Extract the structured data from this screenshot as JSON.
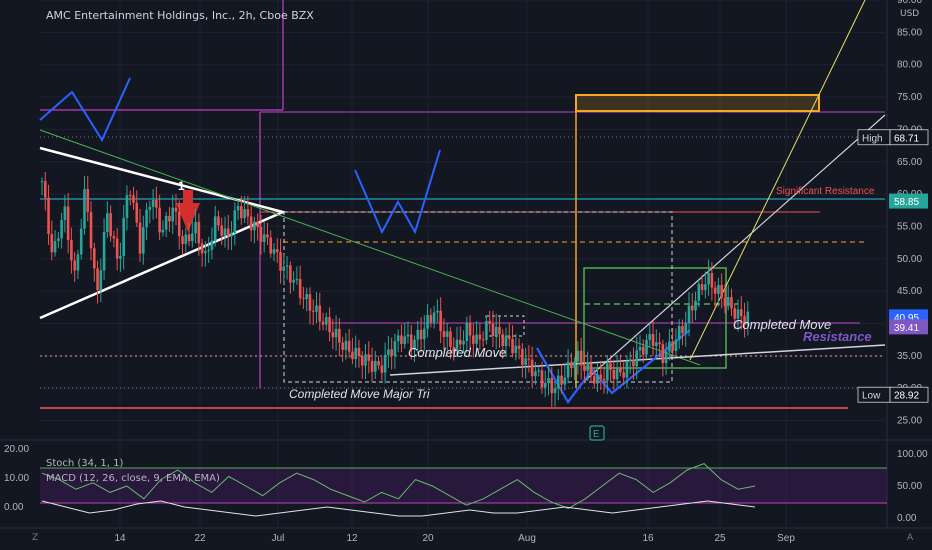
{
  "header": {
    "title": "AMC Entertainment Holdings, Inc., 2h, Cboe BZX",
    "currency": "USD"
  },
  "indicators": {
    "stoch_label": "Stoch (34, 1, 1)",
    "macd_label": "MACD (12, 26, close, 9, EMA, EMA)"
  },
  "corners": {
    "left": "Z",
    "right": "A"
  },
  "colors": {
    "background": "#131722",
    "up": "#26a69a",
    "down": "#ef5350",
    "magenta": "#c040c0",
    "orange": "#f5a623",
    "white": "#ffffff",
    "blue": "#2962ff",
    "green": "#4caf50",
    "purple": "#7e57c2"
  },
  "chart_data": [
    {
      "type": "candlestick",
      "title": "AMC Entertainment Holdings, Inc., 2h, Cboe BZX",
      "x_ticks": [
        "14",
        "22",
        "Jul",
        "12",
        "20",
        "Aug",
        "16",
        "25",
        "Sep"
      ],
      "y_ticks": [
        25,
        30,
        35,
        40,
        45,
        50,
        55,
        60,
        65,
        70,
        75,
        80,
        85,
        90
      ],
      "ylim": [
        22,
        90
      ],
      "price_labels": [
        {
          "text": "High",
          "value": "68.71"
        },
        {
          "text": "",
          "value": "58.85"
        },
        {
          "text": "",
          "value": "40.95"
        },
        {
          "text": "",
          "value": "39.41"
        },
        {
          "text": "Low",
          "value": "28.92"
        }
      ],
      "annotations": {
        "significant_resistance": "Significant Resistance",
        "resistance": "Resistance",
        "completed_move_1": "Completed Move",
        "completed_move_2": "Completed Move",
        "completed_move_major": "Completed Move Major Tri",
        "marker_1": "1",
        "earnings": "E"
      },
      "price_path": [
        [
          0,
          62
        ],
        [
          4,
          50
        ],
        [
          8,
          58
        ],
        [
          12,
          47
        ],
        [
          16,
          61
        ],
        [
          20,
          44
        ],
        [
          24,
          57
        ],
        [
          28,
          49
        ],
        [
          32,
          62
        ],
        [
          36,
          52
        ],
        [
          40,
          60
        ],
        [
          44,
          54
        ],
        [
          48,
          58
        ],
        [
          52,
          52
        ],
        [
          56,
          55
        ],
        [
          60,
          50
        ],
        [
          64,
          56
        ],
        [
          68,
          53
        ],
        [
          72,
          58
        ],
        [
          76,
          56
        ],
        [
          80,
          54
        ],
        [
          84,
          52
        ],
        [
          88,
          49
        ],
        [
          92,
          47
        ],
        [
          96,
          44
        ],
        [
          100,
          42
        ],
        [
          104,
          40
        ],
        [
          108,
          38
        ],
        [
          112,
          36
        ],
        [
          116,
          35
        ],
        [
          120,
          34
        ],
        [
          124,
          33
        ],
        [
          128,
          36
        ],
        [
          132,
          38
        ],
        [
          136,
          37
        ],
        [
          140,
          39
        ],
        [
          144,
          42
        ],
        [
          148,
          38
        ],
        [
          152,
          36
        ],
        [
          156,
          39
        ],
        [
          160,
          37
        ],
        [
          164,
          40
        ],
        [
          168,
          38
        ],
        [
          172,
          37
        ],
        [
          176,
          35
        ],
        [
          180,
          33
        ],
        [
          184,
          31
        ],
        [
          188,
          30
        ],
        [
          192,
          32
        ],
        [
          196,
          35
        ],
        [
          200,
          33
        ],
        [
          204,
          31
        ],
        [
          208,
          33
        ],
        [
          212,
          32
        ],
        [
          216,
          34
        ],
        [
          220,
          36
        ],
        [
          224,
          38
        ],
        [
          228,
          35
        ],
        [
          232,
          37
        ],
        [
          236,
          40
        ],
        [
          240,
          44
        ],
        [
          244,
          47
        ],
        [
          248,
          45
        ],
        [
          252,
          43
        ],
        [
          256,
          41
        ],
        [
          260,
          40.95
        ]
      ]
    },
    {
      "type": "line",
      "title": "Stoch (34, 1, 1)",
      "y_ticks_right": [
        0,
        50,
        100
      ],
      "ylim": [
        0,
        100
      ],
      "values": [
        70,
        60,
        45,
        55,
        40,
        50,
        30,
        60,
        75,
        55,
        40,
        65,
        50,
        35,
        55,
        70,
        60,
        45,
        35,
        25,
        40,
        30,
        60,
        50,
        35,
        20,
        30,
        45,
        60,
        40,
        25,
        15,
        30,
        50,
        70,
        60,
        40,
        55,
        75,
        85,
        60,
        45,
        50
      ]
    },
    {
      "type": "line",
      "title": "MACD (12, 26, close, 9, EMA, EMA)",
      "y_ticks_left": [
        "20.00",
        "10.00",
        "0.00"
      ],
      "ylim": [
        -5,
        20
      ],
      "values": [
        3,
        1,
        -1,
        0,
        2,
        3,
        1,
        0,
        -1,
        -2,
        -1,
        0,
        1,
        0,
        -1,
        -2,
        -2,
        -1,
        0,
        -1,
        -1,
        0,
        1,
        0,
        -1,
        0,
        1,
        2,
        3,
        2,
        1
      ]
    }
  ]
}
